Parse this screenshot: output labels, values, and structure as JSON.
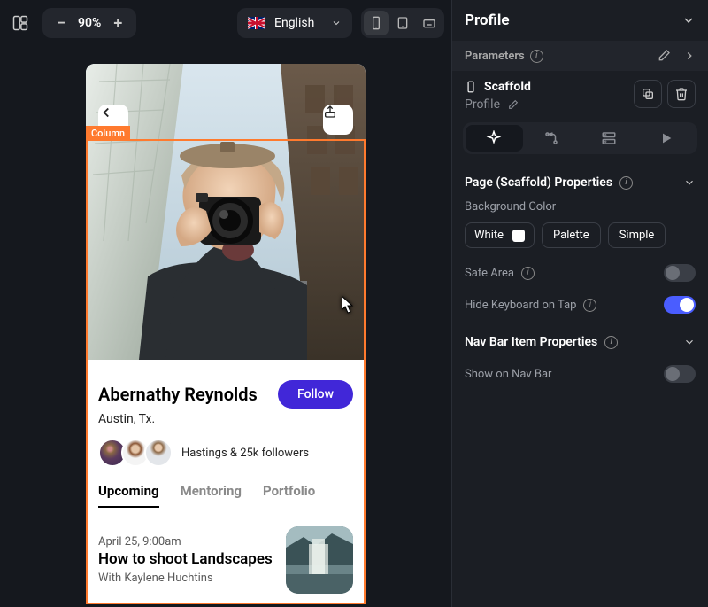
{
  "toolbar": {
    "zoom_level": "90%",
    "language": "English"
  },
  "canvas": {
    "selection_tag": "Column"
  },
  "profile": {
    "name": "Abernathy Reynolds",
    "location": "Austin, Tx.",
    "follow_label": "Follow",
    "followers_text": "Hastings & 25k followers",
    "tabs": [
      "Upcoming",
      "Mentoring",
      "Portfolio"
    ],
    "event": {
      "date": "April 25, 9:00am",
      "title": "How to shoot Landscapes",
      "host": "With Kaylene Huchtins"
    }
  },
  "right_panel": {
    "title": "Profile",
    "parameters_label": "Parameters",
    "scaffold": {
      "name": "Scaffold",
      "subtitle": "Profile"
    },
    "page_props": {
      "title": "Page (Scaffold) Properties",
      "bg_label": "Background Color",
      "bg_value": "White",
      "palette_label": "Palette",
      "simple_label": "Simple",
      "safe_area_label": "Safe Area",
      "hide_kb_label": "Hide Keyboard on Tap"
    },
    "navbar_props": {
      "title": "Nav Bar Item Properties",
      "show_label": "Show on Nav Bar"
    }
  }
}
